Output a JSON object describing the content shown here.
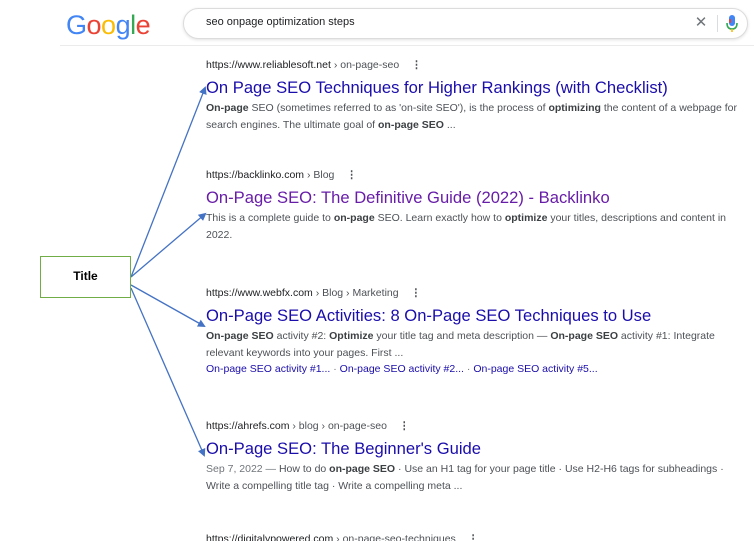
{
  "header": {
    "logo_letters": [
      {
        "ch": "G",
        "color": "#4285F4"
      },
      {
        "ch": "o",
        "color": "#EA4335"
      },
      {
        "ch": "o",
        "color": "#FBBC05"
      },
      {
        "ch": "g",
        "color": "#4285F4"
      },
      {
        "ch": "l",
        "color": "#34A853"
      },
      {
        "ch": "e",
        "color": "#EA4335"
      }
    ],
    "search_value": "seo onpage optimization steps",
    "clear_glyph": "✕",
    "mic_icon": "microphone-icon"
  },
  "results": [
    {
      "url": "https://www.reliablesoft.net",
      "breadcrumb": " › on-page-seo",
      "title": "On Page SEO Techniques for Higher Rankings (with Checklist)",
      "visited": false,
      "snippet_html": "<b>On-page</b> SEO (sometimes referred to as 'on-site SEO'), is the process of <b>optimizing</b> the content of a webpage for search engines. The ultimate goal of <b>on-page SEO</b> ..."
    },
    {
      "url": "https://backlinko.com",
      "breadcrumb": " › Blog",
      "title": "On-Page SEO: The Definitive Guide (2022) - Backlinko",
      "visited": true,
      "snippet_html": "This is a complete guide to <b>on-page</b> SEO. Learn exactly how to <b>optimize</b> your titles, descriptions and content in 2022."
    },
    {
      "url": "https://www.webfx.com",
      "breadcrumb": " › Blog › Marketing",
      "title": "On-Page SEO Activities: 8 On-Page SEO Techniques to Use",
      "visited": false,
      "snippet_html": "<b>On-page SEO</b> activity #2: <b>Optimize</b> your title tag and meta description — <b>On-page SEO</b> activity #1: Integrate relevant keywords into your pages. First ...",
      "sitelinks": [
        "On-page SEO activity #1...",
        "On-page SEO activity #2...",
        "On-page SEO activity #5..."
      ]
    },
    {
      "url": "https://ahrefs.com",
      "breadcrumb": " › blog › on-page-seo",
      "title": "On-Page SEO: The Beginner's Guide",
      "visited": false,
      "date": "Sep 7, 2022 — ",
      "snippet_html": "How to do <b>on-page SEO</b> · Use an H1 tag for your page title · Use H2-H6 tags for subheadings · Write a compelling title tag · Write a compelling meta ..."
    },
    {
      "url": "https://digitalypowered.com",
      "breadcrumb": " › on-page-seo-techniques",
      "partial": true
    }
  ],
  "annotation": {
    "label": "Title",
    "border_color": "#70ad47",
    "arrow_color": "#4472c4",
    "arrow_targets": 4
  },
  "colors": {
    "link": "#1a0dab",
    "visited": "#681da8",
    "snippet": "#4d5156",
    "mic_blue": "#4285F4",
    "mic_red": "#EA4335"
  }
}
